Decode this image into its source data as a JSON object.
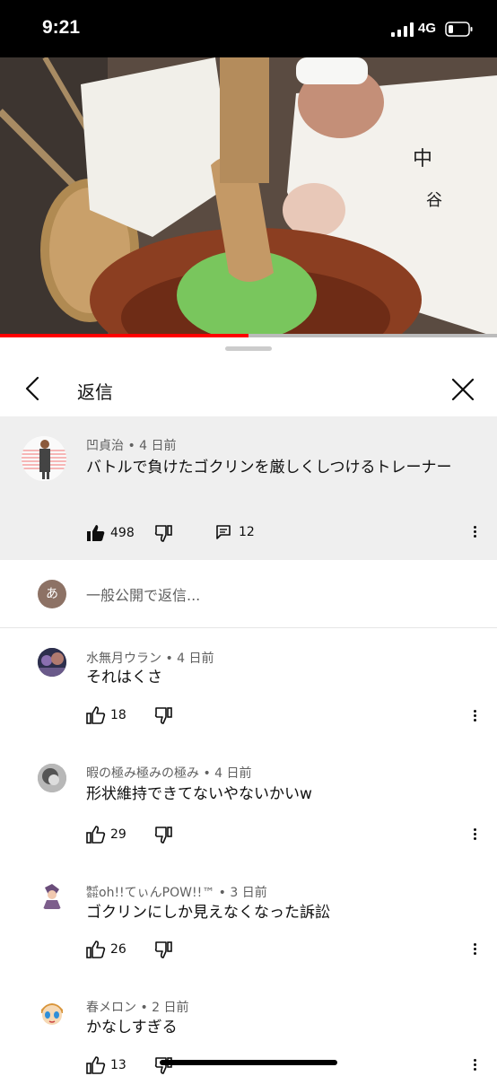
{
  "status": {
    "time": "9:21",
    "network": "4G"
  },
  "panel": {
    "title": "返信"
  },
  "parent_comment": {
    "author": "凹貞治",
    "age": "4 日前",
    "text": "バトルで負けたゴクリンを厳しくしつけるトレーナー",
    "likes": "498",
    "replies": "12"
  },
  "composer": {
    "placeholder": "一般公開で返信...",
    "avatar_letter": "あ"
  },
  "replies": [
    {
      "author": "水無月ウラン",
      "age": "4 日前",
      "text": "それはくさ",
      "likes": "18"
    },
    {
      "author": "暇の極み極みの極み",
      "age": "4 日前",
      "text": "形状維持できてないやないかいw",
      "likes": "29"
    },
    {
      "author": "㍿oh!!てぃんPOW!!™",
      "age": "3 日前",
      "text": "ゴクリンにしか見えなくなった訴訟",
      "likes": "26"
    },
    {
      "author": "春メロン",
      "age": "2 日前",
      "text": "かなしすぎる",
      "likes": "13"
    }
  ],
  "separator": "•"
}
